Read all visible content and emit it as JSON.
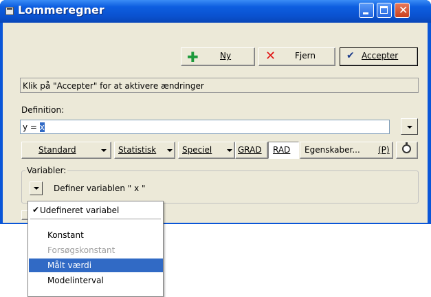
{
  "window": {
    "title": "Lommeregner"
  },
  "toolbar": {
    "new_label": "Ny",
    "delete_label": "Fjern",
    "accept_label": "Accepter"
  },
  "message": "Klik på \"Accepter\" for at aktivere ændringer",
  "definition": {
    "label": "Definition:",
    "value_prefix": "y = ",
    "value_selected": "x"
  },
  "modes": {
    "standard": "Standard",
    "statistics": "Statistisk",
    "special": "Speciel",
    "grad": "GRAD",
    "rad": "RAD",
    "properties": "Egenskaber...",
    "properties_shortcut": "(P)"
  },
  "variables": {
    "label": "Variabler:",
    "define_text": "Definer variablen \" x \""
  },
  "menu": {
    "items": [
      {
        "label": "Udefineret variabel",
        "checked": true
      },
      {
        "label": "Konstant"
      },
      {
        "label": "Forsøgskonstant",
        "disabled": true
      },
      {
        "label": "Målt værdi",
        "highlighted": true
      },
      {
        "label": "Modelinterval"
      }
    ]
  },
  "colors": {
    "titlebar": "#0a56d8",
    "highlight": "#316ac5",
    "face": "#ece9d8"
  }
}
